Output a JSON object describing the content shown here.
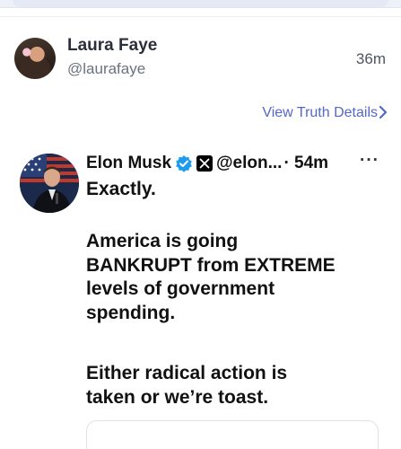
{
  "post": {
    "author_name": "Laura Faye",
    "author_handle": "@laurafaye",
    "time_ago": "36m",
    "view_link_label": "View Truth Details"
  },
  "embedded": {
    "author_name": "Elon Musk",
    "handle": "@elon...",
    "time": "· 54m",
    "more": "···",
    "icons": {
      "verified": "verified-badge-icon",
      "x": "x-logo-icon"
    },
    "text": {
      "line1": "Exactly.",
      "para2": [
        "America is going",
        "BANKRUPT from EXTREME",
        "levels of government",
        "spending."
      ],
      "para3": [
        "Either radical action is",
        "taken or we’re toast."
      ]
    }
  },
  "colors": {
    "link": "#5468c7",
    "verified": "#1d9bf0"
  }
}
